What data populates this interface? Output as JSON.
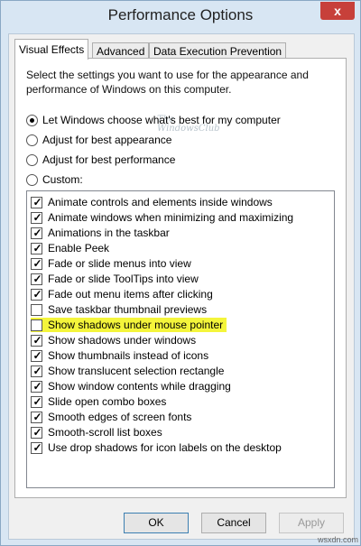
{
  "window": {
    "title": "Performance Options",
    "close_glyph": "x"
  },
  "tabs": [
    {
      "label": "Visual Effects",
      "active": true
    },
    {
      "label": "Advanced",
      "active": false
    },
    {
      "label": "Data Execution Prevention",
      "active": false
    }
  ],
  "intro_text": "Select the settings you want to use for the appearance and performance of Windows on this computer.",
  "watermark_lines": [
    "The",
    "WindowsClub"
  ],
  "radios": [
    {
      "label": "Let Windows choose what's best for my computer",
      "checked": true
    },
    {
      "label": "Adjust for best appearance",
      "checked": false
    },
    {
      "label": "Adjust for best performance",
      "checked": false
    },
    {
      "label": "Custom:",
      "checked": false
    }
  ],
  "effects": [
    {
      "label": "Animate controls and elements inside windows",
      "checked": true
    },
    {
      "label": "Animate windows when minimizing and maximizing",
      "checked": true
    },
    {
      "label": "Animations in the taskbar",
      "checked": true
    },
    {
      "label": "Enable Peek",
      "checked": true
    },
    {
      "label": "Fade or slide menus into view",
      "checked": true
    },
    {
      "label": "Fade or slide ToolTips into view",
      "checked": true
    },
    {
      "label": "Fade out menu items after clicking",
      "checked": true
    },
    {
      "label": "Save taskbar thumbnail previews",
      "checked": false
    },
    {
      "label": "Show shadows under mouse pointer",
      "checked": false,
      "highlight": true
    },
    {
      "label": "Show shadows under windows",
      "checked": true
    },
    {
      "label": "Show thumbnails instead of icons",
      "checked": true
    },
    {
      "label": "Show translucent selection rectangle",
      "checked": true
    },
    {
      "label": "Show window contents while dragging",
      "checked": true
    },
    {
      "label": "Slide open combo boxes",
      "checked": true
    },
    {
      "label": "Smooth edges of screen fonts",
      "checked": true
    },
    {
      "label": "Smooth-scroll list boxes",
      "checked": true
    },
    {
      "label": "Use drop shadows for icon labels on the desktop",
      "checked": true
    }
  ],
  "buttons": {
    "ok": "OK",
    "cancel": "Cancel",
    "apply": "Apply"
  },
  "site_watermark": "wsxdn.com",
  "colors": {
    "highlight": "#f4f53b",
    "close": "#c7403a",
    "frame": "#d8e6f3"
  }
}
